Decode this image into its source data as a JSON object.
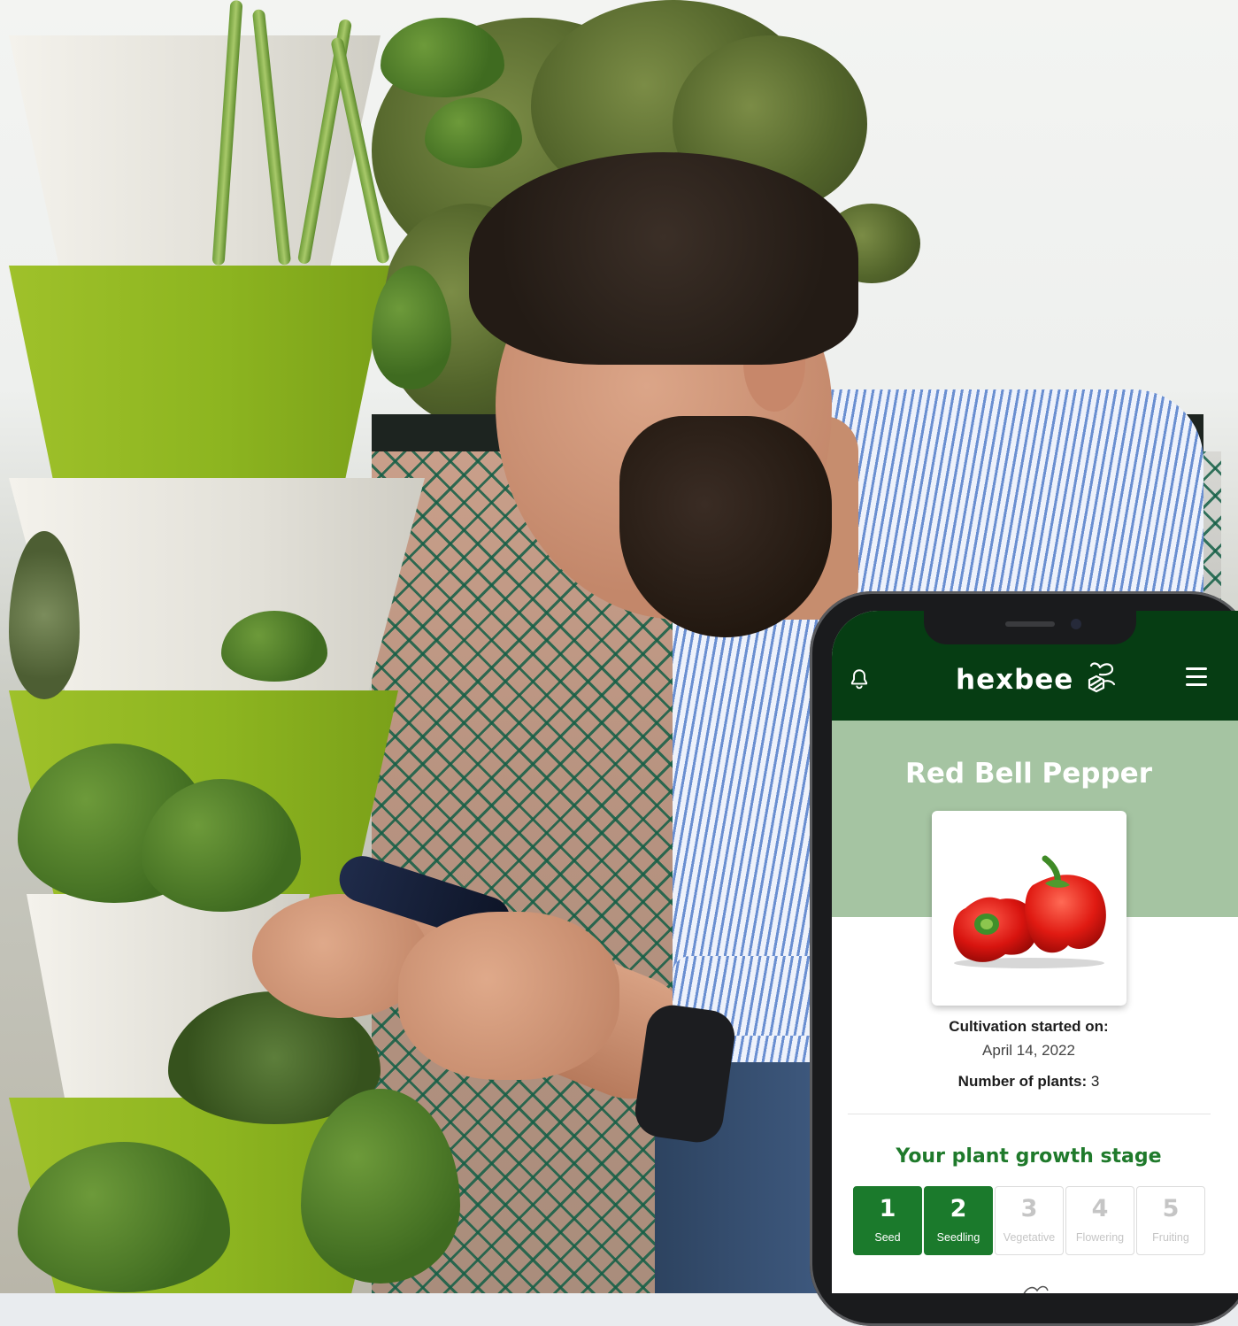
{
  "app": {
    "logo_text": "hexbee",
    "icons": {
      "notifications": "bell-icon",
      "menu": "hamburger-menu-icon",
      "logo": "bee-icon"
    },
    "colors": {
      "header": "#063d13",
      "hero": "#a5c4a2",
      "accent": "#1b7a2c",
      "title_green": "#1f7a2b"
    }
  },
  "plant": {
    "name": "Red Bell Pepper",
    "cultivation_label": "Cultivation started on:",
    "cultivation_date": "April 14, 2022",
    "plants_label": "Number of plants:",
    "plants_count": "3"
  },
  "growth": {
    "title": "Your plant growth stage",
    "stages": [
      {
        "num": "1",
        "name": "Seed",
        "active": true
      },
      {
        "num": "2",
        "name": "Seedling",
        "active": true
      },
      {
        "num": "3",
        "name": "Vegetative",
        "active": false
      },
      {
        "num": "4",
        "name": "Flowering",
        "active": false
      },
      {
        "num": "5",
        "name": "Fruiting",
        "active": false
      }
    ]
  }
}
